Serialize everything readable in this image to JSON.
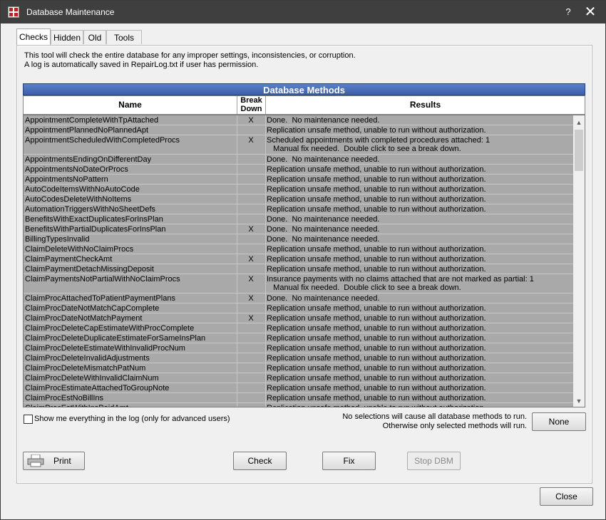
{
  "window": {
    "title": "Database Maintenance",
    "help_glyph": "?",
    "close_glyph": "✕"
  },
  "tabs": [
    "Checks",
    "Hidden",
    "Old",
    "Tools"
  ],
  "info": {
    "line1": "This tool will check the entire database for any improper settings, inconsistencies, or corruption.",
    "line2": "A log is automatically saved in RepairLog.txt if user has permission."
  },
  "grid": {
    "title": "Database Methods",
    "headers": {
      "name": "Name",
      "breakdown_line1": "Break",
      "breakdown_line2": "Down",
      "results": "Results"
    },
    "rows": [
      {
        "name": "AppointmentCompleteWithTpAttached",
        "bd": "X",
        "result": "Done.  No maintenance needed."
      },
      {
        "name": "AppointmentPlannedNoPlannedApt",
        "bd": "",
        "result": "Replication unsafe method, unable to run without authorization."
      },
      {
        "name": "AppointmentScheduledWithCompletedProcs",
        "bd": "X",
        "result": "Scheduled appointments with completed procedures attached: 1\n   Manual fix needed.  Double click to see a break down."
      },
      {
        "name": "AppointmentsEndingOnDifferentDay",
        "bd": "",
        "result": "Done.  No maintenance needed."
      },
      {
        "name": "AppointmentsNoDateOrProcs",
        "bd": "",
        "result": "Replication unsafe method, unable to run without authorization."
      },
      {
        "name": "AppointmentsNoPattern",
        "bd": "",
        "result": "Replication unsafe method, unable to run without authorization."
      },
      {
        "name": "AutoCodeItemsWithNoAutoCode",
        "bd": "",
        "result": "Replication unsafe method, unable to run without authorization."
      },
      {
        "name": "AutoCodesDeleteWithNoItems",
        "bd": "",
        "result": "Replication unsafe method, unable to run without authorization."
      },
      {
        "name": "AutomationTriggersWithNoSheetDefs",
        "bd": "",
        "result": "Replication unsafe method, unable to run without authorization."
      },
      {
        "name": "BenefitsWithExactDuplicatesForInsPlan",
        "bd": "",
        "result": "Done.  No maintenance needed."
      },
      {
        "name": "BenefitsWithPartialDuplicatesForInsPlan",
        "bd": "X",
        "result": "Done.  No maintenance needed."
      },
      {
        "name": "BillingTypesInvalid",
        "bd": "",
        "result": "Done.  No maintenance needed."
      },
      {
        "name": "ClaimDeleteWithNoClaimProcs",
        "bd": "",
        "result": "Replication unsafe method, unable to run without authorization."
      },
      {
        "name": "ClaimPaymentCheckAmt",
        "bd": "X",
        "result": "Replication unsafe method, unable to run without authorization."
      },
      {
        "name": "ClaimPaymentDetachMissingDeposit",
        "bd": "",
        "result": "Replication unsafe method, unable to run without authorization."
      },
      {
        "name": "ClaimPaymentsNotPartialWithNoClaimProcs",
        "bd": "X",
        "result": "Insurance payments with no claims attached that are not marked as partial: 1\n   Manual fix needed.  Double click to see a break down."
      },
      {
        "name": "ClaimProcAttachedToPatientPaymentPlans",
        "bd": "X",
        "result": "Done.  No maintenance needed."
      },
      {
        "name": "ClaimProcDateNotMatchCapComplete",
        "bd": "",
        "result": "Replication unsafe method, unable to run without authorization."
      },
      {
        "name": "ClaimProcDateNotMatchPayment",
        "bd": "X",
        "result": "Replication unsafe method, unable to run without authorization."
      },
      {
        "name": "ClaimProcDeleteCapEstimateWithProcComplete",
        "bd": "",
        "result": "Replication unsafe method, unable to run without authorization."
      },
      {
        "name": "ClaimProcDeleteDuplicateEstimateForSameInsPlan",
        "bd": "",
        "result": "Replication unsafe method, unable to run without authorization."
      },
      {
        "name": "ClaimProcDeleteEstimateWithInvalidProcNum",
        "bd": "",
        "result": "Replication unsafe method, unable to run without authorization."
      },
      {
        "name": "ClaimProcDeleteInvalidAdjustments",
        "bd": "",
        "result": "Replication unsafe method, unable to run without authorization."
      },
      {
        "name": "ClaimProcDeleteMismatchPatNum",
        "bd": "",
        "result": "Replication unsafe method, unable to run without authorization."
      },
      {
        "name": "ClaimProcDeleteWithInvalidClaimNum",
        "bd": "",
        "result": "Replication unsafe method, unable to run without authorization."
      },
      {
        "name": "ClaimProcEstimateAttachedToGroupNote",
        "bd": "",
        "result": "Replication unsafe method, unable to run without authorization."
      },
      {
        "name": "ClaimProcEstNoBillIns",
        "bd": "",
        "result": "Replication unsafe method, unable to run without authorization."
      },
      {
        "name": "ClaimProcEstWithInsPaidAmt",
        "bd": "",
        "result": "Replication unsafe method, unable to run without authorization."
      }
    ]
  },
  "options": {
    "show_log_label": "Show me everything in the log  (only for advanced users)",
    "show_log_checked": false,
    "note_line1": "No selections will cause all database methods to run.",
    "note_line2": "Otherwise only selected methods will run."
  },
  "buttons": {
    "none": "None",
    "print": "Print",
    "check": "Check",
    "fix": "Fix",
    "stop": "Stop DBM",
    "close": "Close"
  },
  "colors": {
    "titlebar": "#3f3f3f",
    "grid_title": "#4b6cb7",
    "grid_body": "#a9a9a9"
  }
}
